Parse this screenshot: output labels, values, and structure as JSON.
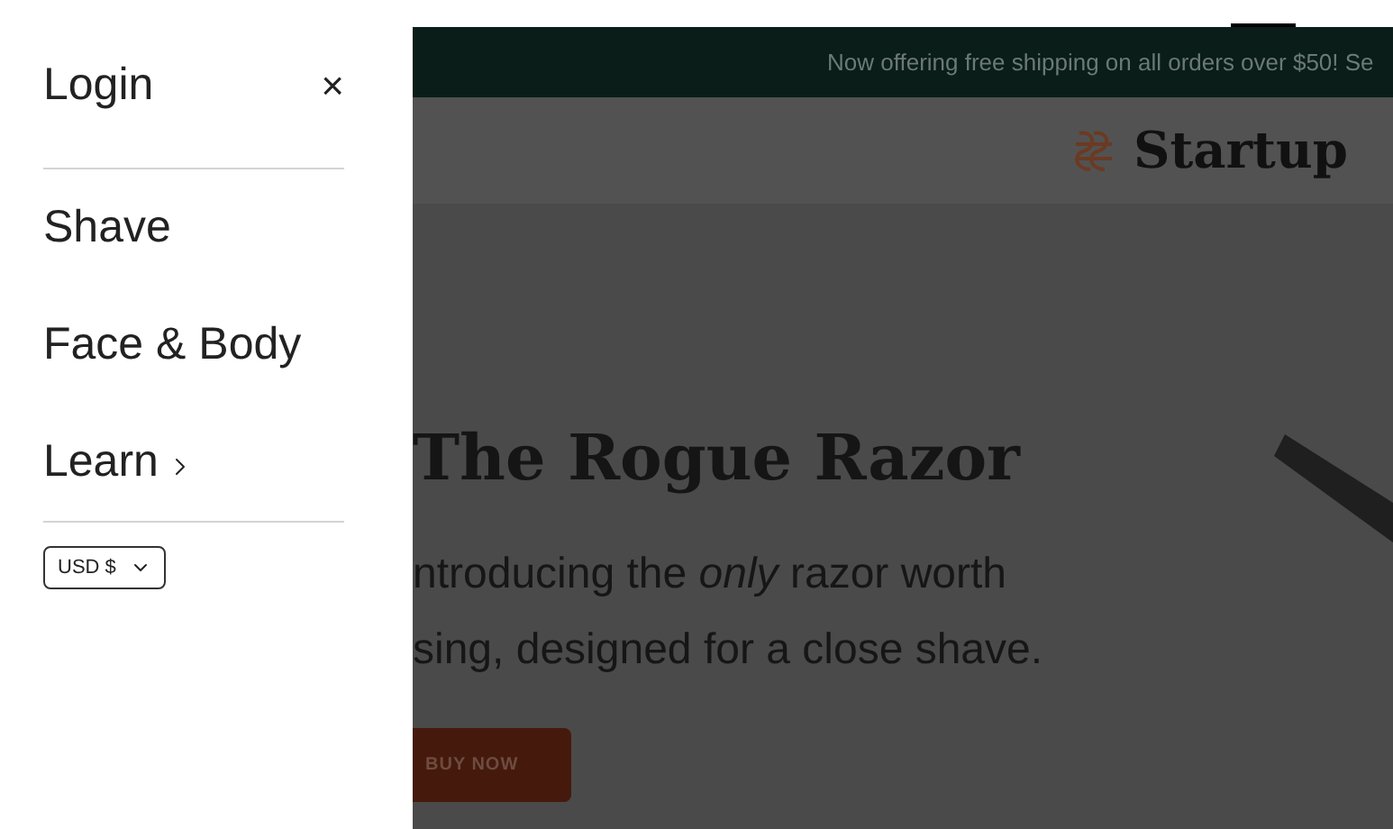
{
  "drawer": {
    "title": "Login",
    "close": "×",
    "items": [
      {
        "label": "Shave",
        "kind": "link"
      },
      {
        "label": "Face & Body",
        "kind": "link"
      },
      {
        "label": "Learn",
        "kind": "submenu"
      }
    ],
    "currency": "USD $"
  },
  "announcement": "Now offering free shipping on all orders over $50! Se",
  "header": {
    "logo": "Startup"
  },
  "hero": {
    "heading": "The Rogue Razor",
    "subtitle": [
      "ntroducing the *only* razor worth",
      "sing, designed for a close shave."
    ],
    "button": "BUY NOW"
  }
}
